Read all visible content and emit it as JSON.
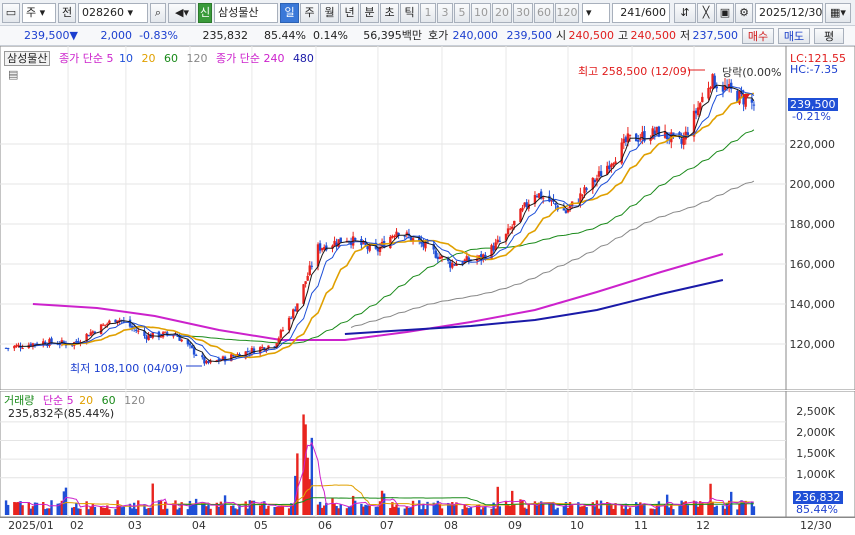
{
  "toolbar": {
    "market": "주",
    "prev_label": "전",
    "code": "028260",
    "badge": "신",
    "name": "삼성물산",
    "periods": [
      "일",
      "주",
      "월",
      "년",
      "분",
      "초",
      "틱"
    ],
    "intervals": [
      "1",
      "3",
      "5",
      "10",
      "20",
      "30",
      "60",
      "120"
    ],
    "count": "241/600",
    "date": "2025/12/30"
  },
  "quote": {
    "price": "239,500▼",
    "change": "2,000",
    "change_pct": "-0.83%",
    "volume": "235,832",
    "volume_ratio": "85.44%",
    "turnover_pct": "0.14%",
    "amount": "56,395백만",
    "ask_label": "호가",
    "ask": "240,000",
    "bid": "239,500",
    "open_label": "시",
    "open": "240,500",
    "high_label": "고",
    "high": "240,500",
    "low_label": "저",
    "low": "237,500",
    "buy_button": "매수",
    "sell_button": "매도",
    "eval_button": "평"
  },
  "price_legend": {
    "stock": "삼성물산",
    "ma_label": "종가 단순 5",
    "ma": [
      "10",
      "20",
      "60",
      "120"
    ],
    "ma_long_label": "종가 단순 240",
    "ma_long": "480"
  },
  "annotations": {
    "high": "최고 258,500 (12/09)",
    "low": "최저 108,100 (04/09)",
    "hold": "당락(0.00%",
    "lc": "LC:121.55",
    "hc": "HC:-7.35",
    "current_price": "239,500",
    "current_pct": "-0.21%"
  },
  "volume_legend": {
    "label": "거래량",
    "ma_label": "단순 5",
    "ma": [
      "20",
      "60",
      "120"
    ],
    "summary": "235,832주(85.44%)",
    "current": "236,832",
    "current_pct": "85.44%"
  },
  "colors": {
    "up": "#e8241e",
    "down": "#1f4fd6",
    "ma5": "#1a1a1a",
    "ma10": "#1e4fd8",
    "ma20": "#e0a000",
    "ma60": "#1a8a1a",
    "ma120": "#888888",
    "ma240": "#cc22cc",
    "ma480": "#1a1aa8"
  },
  "chart_data": {
    "type": "candlestick",
    "title": "삼성물산",
    "y_ticks": [
      "120,000",
      "140,000",
      "160,000",
      "180,000",
      "200,000",
      "220,000"
    ],
    "ylim": [
      100000,
      262000
    ],
    "x_ticks": [
      "2025/01",
      "02",
      "03",
      "04",
      "05",
      "06",
      "07",
      "08",
      "09",
      "10",
      "11",
      "12",
      "12/30"
    ],
    "close_path": [
      [
        "2025/01/02",
        118000
      ],
      [
        "2025/01/20",
        121000
      ],
      [
        "2025/02/03",
        120000
      ],
      [
        "2025/02/14",
        127000
      ],
      [
        "2025/02/25",
        133000
      ],
      [
        "2025/03/10",
        124000
      ],
      [
        "2025/03/25",
        125000
      ],
      [
        "2025/04/09",
        110000
      ],
      [
        "2025/04/25",
        115000
      ],
      [
        "2025/05/12",
        120000
      ],
      [
        "2025/05/22",
        138000
      ],
      [
        "2025/06/02",
        168000
      ],
      [
        "2025/06/16",
        173000
      ],
      [
        "2025/06/30",
        166000
      ],
      [
        "2025/07/10",
        177000
      ],
      [
        "2025/07/25",
        168000
      ],
      [
        "2025/08/05",
        160000
      ],
      [
        "2025/08/20",
        163000
      ],
      [
        "2025/09/01",
        174000
      ],
      [
        "2025/09/15",
        196000
      ],
      [
        "2025/09/30",
        186000
      ],
      [
        "2025/10/15",
        203000
      ],
      [
        "2025/10/30",
        222000
      ],
      [
        "2025/11/14",
        226000
      ],
      [
        "2025/11/25",
        220000
      ],
      [
        "2025/12/09",
        252000
      ],
      [
        "2025/12/30",
        239500
      ]
    ],
    "series_ma": [
      {
        "name": "240",
        "values": [
          140000,
          138000,
          134000,
          127000,
          122000,
          122000,
          126000,
          131000,
          137000,
          146000,
          156000,
          165000
        ]
      },
      {
        "name": "480",
        "values": [
          null,
          null,
          null,
          null,
          null,
          125000,
          127000,
          129000,
          132000,
          137000,
          145000,
          152000
        ]
      }
    ],
    "volume": {
      "y_ticks": [
        "1,000K",
        "1,500K",
        "2,000K",
        "2,500K"
      ],
      "ylim": [
        0,
        2900000
      ],
      "max_spike": 2700000
    }
  }
}
